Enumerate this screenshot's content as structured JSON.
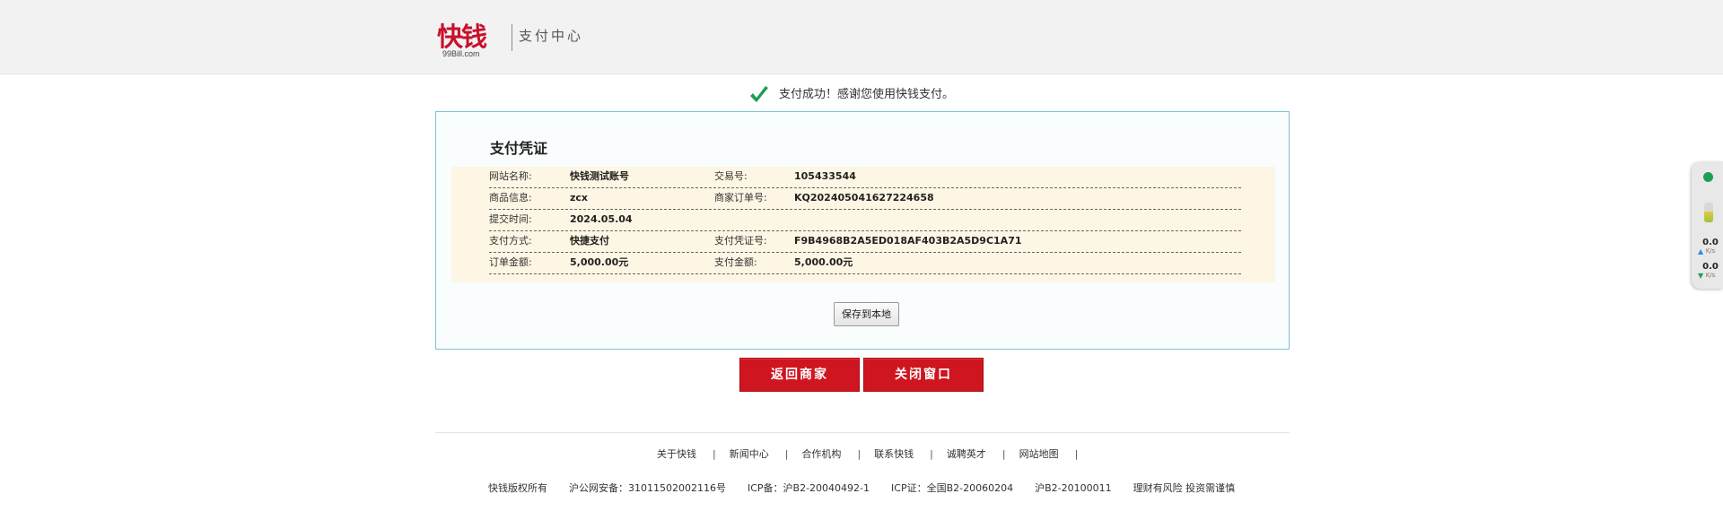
{
  "header": {
    "logo_text": "快钱",
    "logo_domain": "99Bill.com",
    "title": "支付中心"
  },
  "status": {
    "success_text": "支付成功！感谢您使用快钱支付。",
    "success_color": "#1f9d55"
  },
  "receipt": {
    "title": "支付凭证",
    "rows": [
      {
        "label1": "网站名称:",
        "value1": "快钱测试账号",
        "label2": "交易号:",
        "value2": "105433544"
      },
      {
        "label1": "商品信息:",
        "value1": "zcx",
        "label2": "商家订单号:",
        "value2": "KQ20240504162722465 8"
      },
      {
        "label1": "提交时间:",
        "value1": "2024.05.04",
        "label2": "",
        "value2": ""
      },
      {
        "label1": "支付方式:",
        "value1": "快捷支付",
        "label2": "支付凭证号:",
        "value2": "F9B4968B2A5ED018AF403B2A5D9C1A71"
      },
      {
        "label1": "订单金额:",
        "value1": "5,000.00元",
        "label2": "支付金额:",
        "value2": "5,000.00元"
      }
    ],
    "save_label": "保存到本地"
  },
  "actions": {
    "return_label": "返回商家",
    "close_label": "关闭窗口",
    "accent_color": "#cf1520"
  },
  "footer": {
    "links": [
      "关于快钱",
      "新闻中心",
      "合作机构",
      "联系快钱",
      "诚聘英才",
      "网站地图"
    ],
    "copyright": [
      "快钱版权所有",
      "沪公网安备：31011502002116号",
      "ICP备：沪B2-20040492-1",
      "ICP证：全国B2-20060204",
      "沪B2-20100011",
      "理财有风险 投资需谨慎"
    ]
  },
  "side_widget": {
    "up_speed": "0.0",
    "up_unit": "K/s",
    "down_speed": "0.0",
    "down_unit": "K/s"
  }
}
